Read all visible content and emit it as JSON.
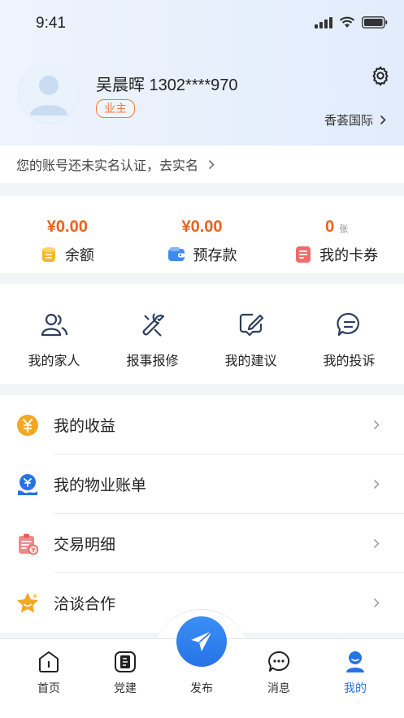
{
  "status": {
    "time": "9:41"
  },
  "profile": {
    "name": "吴晨晖 1302****970",
    "role_badge": "业主",
    "community": "香荟国际"
  },
  "verify": {
    "text": "您的账号还未实名认证，去实名"
  },
  "wallet": {
    "balance": {
      "value": "¥0.00",
      "label": "余额"
    },
    "deposit": {
      "value": "¥0.00",
      "label": "预存款"
    },
    "coupons": {
      "value": "0",
      "unit": "张",
      "label": "我的卡券"
    }
  },
  "services": [
    {
      "label": "我的家人",
      "icon": "family-icon"
    },
    {
      "label": "报事报修",
      "icon": "repair-icon"
    },
    {
      "label": "我的建议",
      "icon": "suggestion-icon"
    },
    {
      "label": "我的投诉",
      "icon": "complaint-icon"
    }
  ],
  "menu": [
    {
      "label": "我的收益",
      "icon": "income-icon"
    },
    {
      "label": "我的物业账单",
      "icon": "bill-icon"
    },
    {
      "label": "交易明细",
      "icon": "transaction-icon"
    },
    {
      "label": "洽谈合作",
      "icon": "cooperation-icon"
    }
  ],
  "tabs": {
    "home": "首页",
    "party": "党建",
    "publish": "发布",
    "messages": "消息",
    "mine": "我的"
  },
  "colors": {
    "accent": "#2673e6",
    "price": "#e8621e",
    "badge": "#f07b3a",
    "active_tab": "#2673e6"
  }
}
